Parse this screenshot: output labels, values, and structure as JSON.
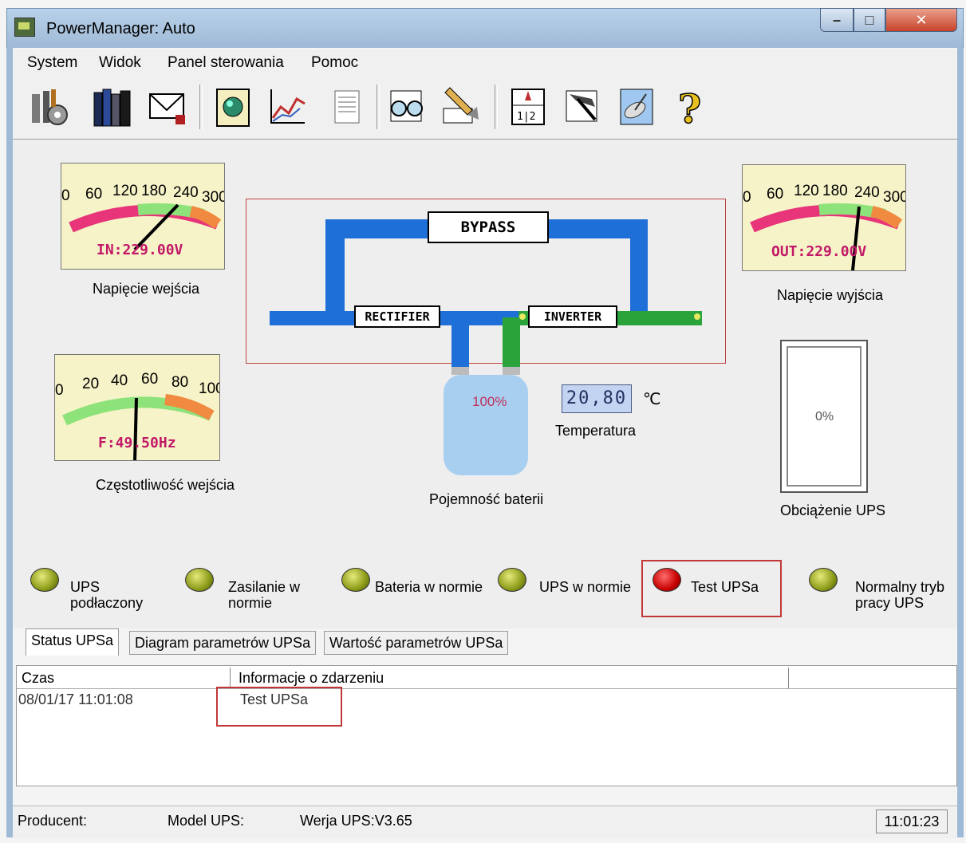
{
  "window": {
    "title": "PowerManager: Auto"
  },
  "menu": {
    "items": [
      {
        "label": "System"
      },
      {
        "label": "Widok"
      },
      {
        "label": "Panel sterowania"
      },
      {
        "label": "Pomoc"
      }
    ]
  },
  "toolbar": {
    "buttons": [
      "settings-icon",
      "books-icon",
      "mail-icon",
      "globe-icon",
      "chart-icon",
      "notes-icon",
      "glasses-icon",
      "brush-icon",
      "schedule-icon",
      "tools-icon",
      "satellite-icon",
      "help-icon"
    ]
  },
  "gauges": {
    "input_voltage": {
      "ticks": [
        "0",
        "60",
        "120",
        "180",
        "240",
        "300"
      ],
      "value_text": "IN:229.00V",
      "caption": "Napięcie wejścia",
      "value": 229,
      "max": 300
    },
    "output_voltage": {
      "ticks": [
        "0",
        "60",
        "120",
        "180",
        "240",
        "300"
      ],
      "value_text": "OUT:229.00V",
      "caption": "Napięcie wyjścia",
      "value": 229,
      "max": 300
    },
    "frequency": {
      "ticks": [
        "0",
        "20",
        "40",
        "60",
        "80",
        "100"
      ],
      "value_text": "F:49.50Hz",
      "caption": "Częstotliwość wejścia",
      "value": 49.5,
      "max": 100
    }
  },
  "diagram": {
    "bypass": "BYPASS",
    "rectifier": "RECTIFIER",
    "inverter": "INVERTER"
  },
  "battery": {
    "percent_text": "100%",
    "caption": "Pojemność baterii",
    "percent": 100
  },
  "temperature": {
    "value": "20,80",
    "unit": "℃",
    "caption": "Temperatura"
  },
  "load": {
    "percent_text": "0%",
    "caption": "Obciążenie UPS",
    "percent": 0
  },
  "indicators": [
    {
      "label": "UPS podłaczony",
      "color": "olive"
    },
    {
      "label": "Zasilanie w normie",
      "color": "olive"
    },
    {
      "label": "Bateria w normie",
      "color": "olive"
    },
    {
      "label": "UPS w normie",
      "color": "olive"
    },
    {
      "label": "Test UPSa",
      "color": "red"
    },
    {
      "label": "Normalny tryb pracy UPS",
      "color": "olive"
    }
  ],
  "tabs": [
    {
      "label": "Status UPSa",
      "active": true
    },
    {
      "label": "Diagram parametrów UPSa",
      "active": false
    },
    {
      "label": "Wartość parametrów UPSa",
      "active": false
    }
  ],
  "events": {
    "columns": [
      "Czas",
      "Informacje o zdarzeniu"
    ],
    "rows": [
      {
        "time": "08/01/17 11:01:08",
        "info": "Test UPSa"
      }
    ]
  },
  "statusbar": {
    "producer": "Producent:",
    "model": "Model UPS:",
    "version": "Werja UPS:V3.65",
    "clock": "11:01:23"
  },
  "colors": {
    "pipe_blue": "#1f6fd8",
    "pipe_green": "#2aa43a",
    "led_olive": "#8b9a18",
    "led_red": "#c80000",
    "highlight": "#c03838"
  }
}
